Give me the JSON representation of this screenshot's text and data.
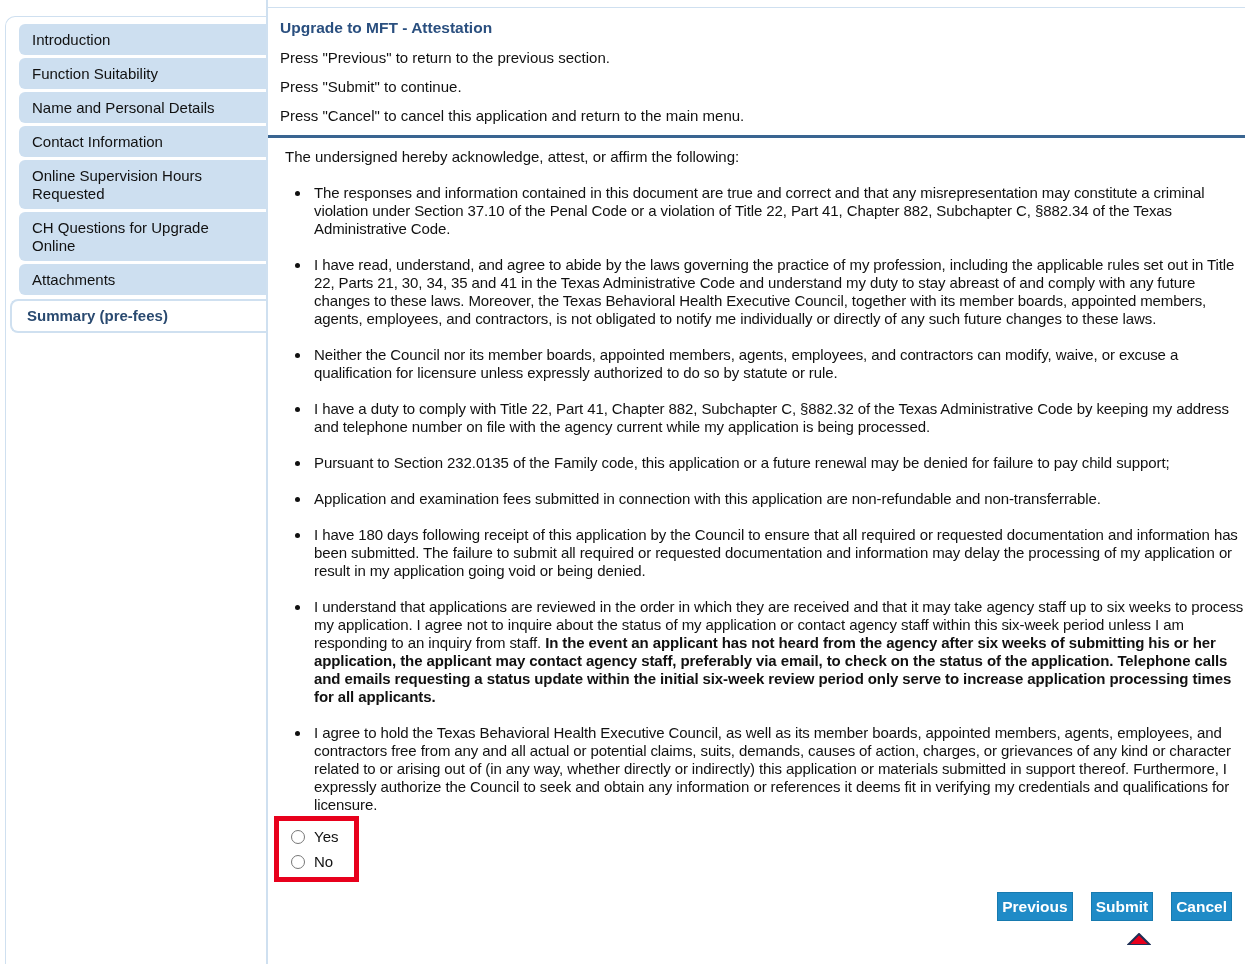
{
  "sidebar": {
    "items": [
      {
        "label": "Introduction",
        "selected": false
      },
      {
        "label": "Function Suitability",
        "selected": false
      },
      {
        "label": "Name and Personal Details",
        "selected": false
      },
      {
        "label": "Contact Information",
        "selected": false
      },
      {
        "label": "Online Supervision Hours Requested",
        "selected": false
      },
      {
        "label": "CH Questions for Upgrade Online",
        "selected": false
      },
      {
        "label": "Attachments",
        "selected": false
      },
      {
        "label": "Summary (pre-fees)",
        "selected": true
      }
    ]
  },
  "header": {
    "title": "Upgrade to MFT - Attestation",
    "instructions": [
      "Press \"Previous\" to return to the previous section.",
      "Press \"Submit\" to continue.",
      "Press \"Cancel\" to cancel this application and return to the main menu."
    ]
  },
  "attestation": {
    "intro": "The undersigned hereby acknowledge, attest, or affirm the following:",
    "items": [
      "The responses and information contained in this document are true and correct and that any misrepresentation may constitute a criminal violation under Section 37.10 of the Penal Code or a violation of Title 22, Part 41, Chapter 882, Subchapter C, §882.34 of the Texas Administrative Code.",
      "I have read, understand, and agree to abide by the laws governing the practice of my profession, including the applicable rules set out in Title 22, Parts 21, 30, 34, 35 and 41 in the Texas Administrative Code and understand my duty to stay abreast of and comply with any future changes to these laws. Moreover, the Texas Behavioral Health Executive Council, together with its member boards, appointed members, agents, employees, and contractors, is not obligated to notify me individually or directly of any such future changes to these laws.",
      "Neither the Council nor its member boards, appointed members, agents, employees, and contractors can modify, waive, or excuse a qualification for licensure unless expressly authorized to do so by statute or rule.",
      "I have a duty to comply with Title 22, Part 41, Chapter 882, Subchapter C, §882.32 of the Texas Administrative Code by keeping my address and telephone number on file with the agency current while my application is being processed.",
      "Pursuant to Section 232.0135 of the Family code, this application or a future renewal may be denied for failure to pay child support;",
      "Application and examination fees submitted in connection with this application are non-refundable and non-transferrable.",
      "I have 180 days following receipt of this application by the Council to ensure that all required or requested documentation and information has been submitted. The failure to submit all required or requested documentation and information may delay the processing of my application or result in my application going void or being denied.",
      "I understand that applications are reviewed in the order in which they are received and that it may take agency staff up to six weeks to process my application. I agree not to inquire about the status of my application or contact agency staff within this six-week period unless I am responding to an inquiry from staff. **In the event an applicant has not heard from the agency after six weeks of submitting his or her application, the applicant may contact agency staff, preferably via email, to check on the status of the application. Telephone calls and emails requesting a status update within the initial six-week review period only serve to increase application processing times for all applicants.**",
      "I agree to hold the Texas Behavioral Health Executive Council, as well as its member boards, appointed members, agents, employees, and contractors free from any and all actual or potential claims, suits, demands, causes of action, charges, or grievances of any kind or character related to or arising out of (in any way, whether directly or indirectly) this application or materials submitted in support thereof. Furthermore, I expressly authorize the Council to seek and obtain any information or references it deems fit in verifying my credentials and qualifications for licensure."
    ],
    "options": [
      {
        "label": "Yes",
        "selected": false
      },
      {
        "label": "No",
        "selected": false
      }
    ]
  },
  "buttons": [
    "Previous",
    "Submit",
    "Cancel"
  ]
}
